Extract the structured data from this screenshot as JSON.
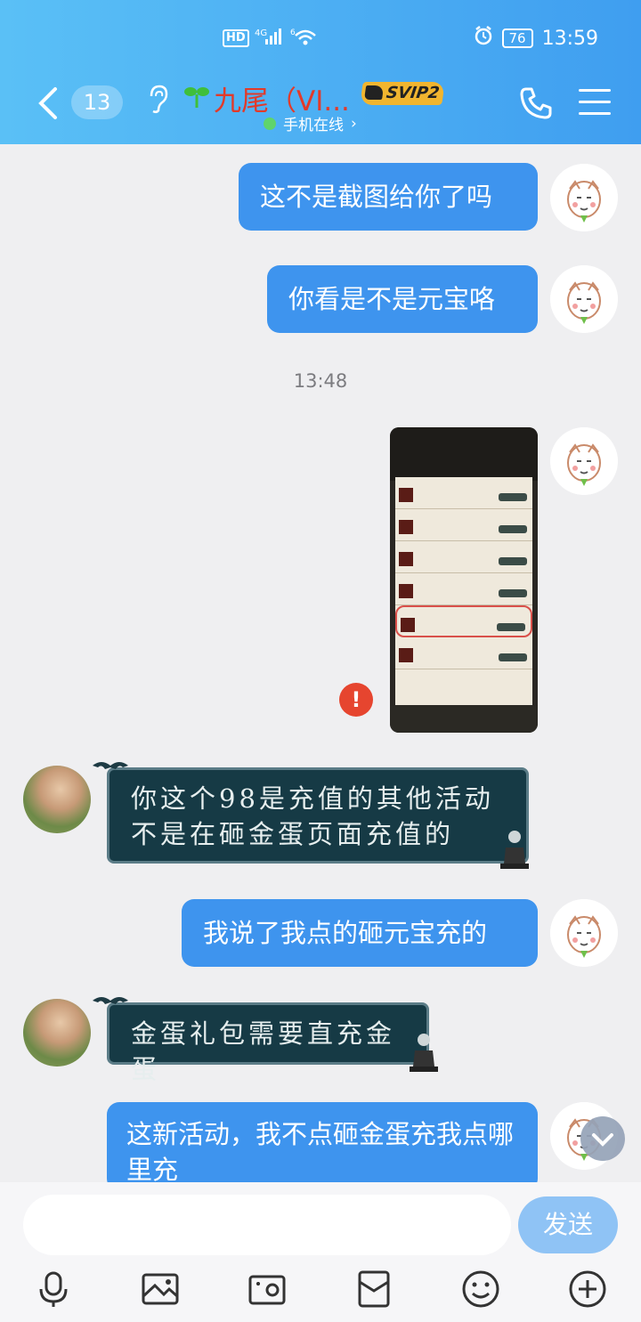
{
  "status_bar": {
    "network": "HD",
    "signal_text": "4G",
    "wifi_text": "6",
    "battery": "76",
    "time": "13:59"
  },
  "nav": {
    "unread_count": "13",
    "contact_name": "九尾（VI...",
    "vip_badge": "SVIP2",
    "presence": "手机在线",
    "presence_chevron": "›"
  },
  "messages": [
    {
      "side": "right",
      "text": "这不是截图给你了吗"
    },
    {
      "side": "right",
      "text": "你看是不是元宝咯"
    },
    {
      "side": "right",
      "type": "image"
    },
    {
      "side": "left",
      "text": "你这个98是充值的其他活动 不是在砸金蛋页面充值的"
    },
    {
      "side": "right",
      "text": "我说了我点的砸元宝充的"
    },
    {
      "side": "left",
      "text": "金蛋礼包需要直充金蛋"
    },
    {
      "side": "right",
      "text": "这新活动，我不点砸金蛋充我点哪里充"
    }
  ],
  "timestamp": "13:48",
  "error_mark": "!",
  "input": {
    "placeholder": "",
    "send_label": "发送"
  },
  "toolbar": [
    "mic-icon",
    "image-icon",
    "camera-icon",
    "red-packet-icon",
    "emoji-icon",
    "plus-icon"
  ],
  "colors": {
    "header_start": "#5ac0f6",
    "header_end": "#3f9ef0",
    "bubble_self": "#3e94ee",
    "bubble_other": "#163a45",
    "name_color": "#e23a2a",
    "vip_gold": "#f1b52f",
    "error_red": "#e6452f",
    "send_button": "#8fc3f5"
  }
}
